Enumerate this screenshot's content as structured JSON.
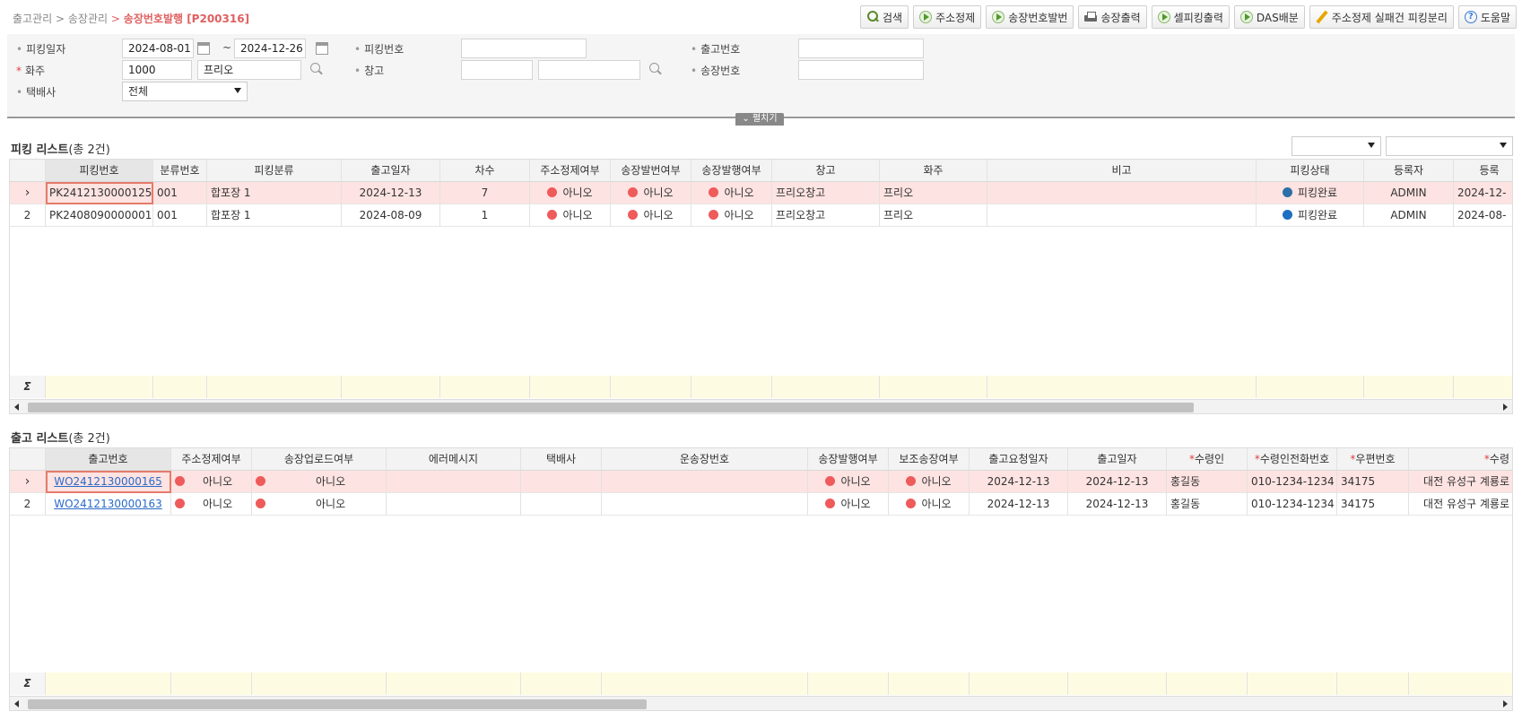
{
  "breadcrumb": {
    "level1": "출고관리",
    "level2": "송장관리",
    "current": "송장번호발행 [P200316]",
    "sep": ">"
  },
  "toolbar": {
    "buttons": [
      {
        "label": "검색",
        "icon": "search-icon"
      },
      {
        "label": "주소정제",
        "icon": "play-icon"
      },
      {
        "label": "송장번호발번",
        "icon": "play-icon"
      },
      {
        "label": "송장출력",
        "icon": "printer-icon"
      },
      {
        "label": "셀피킹출력",
        "icon": "play-icon"
      },
      {
        "label": "DAS배분",
        "icon": "play-icon"
      },
      {
        "label": "주소정제 실패건 피킹분리",
        "icon": "pencil-icon"
      },
      {
        "label": "도움말",
        "icon": "help-icon"
      }
    ]
  },
  "search": {
    "picking_date_label": "피킹일자",
    "date_from": "2024-08-01",
    "date_tilde": "~",
    "date_to": "2024-12-26",
    "owner_label": "화주",
    "owner_code": "1000",
    "owner_name": "프리오",
    "carrier_label": "택배사",
    "carrier_value": "전체",
    "picking_no_label": "피킹번호",
    "picking_no_value": "",
    "warehouse_label": "창고",
    "warehouse_code": "",
    "warehouse_name": "",
    "outbound_no_label": "출고번호",
    "outbound_no_value": "",
    "invoice_no_label": "송장번호",
    "invoice_no_value": "",
    "fold_label": "펼치기"
  },
  "picking_list": {
    "title": "피킹 리스트",
    "count": "(총 2건)",
    "columns": [
      "피킹번호",
      "분류번호",
      "피킹분류",
      "출고일자",
      "차수",
      "주소정제여부",
      "송장발번여부",
      "송장발행여부",
      "창고",
      "화주",
      "비고",
      "피킹상태",
      "등록자",
      "등록"
    ],
    "rows": [
      {
        "rownum": "",
        "picking_no": "PK2412130000125",
        "class_no": "001",
        "picking_class": "합포장 1",
        "out_date": "2024-12-13",
        "seq": "7",
        "addr_clean": "아니오",
        "inv_issue_no": "아니오",
        "inv_print": "아니오",
        "warehouse": "프리오창고",
        "owner": "프리오",
        "note": "",
        "status": "피킹완료",
        "reg_user": "ADMIN",
        "reg_date": "2024-12-"
      },
      {
        "rownum": "2",
        "picking_no": "PK2408090000001",
        "class_no": "001",
        "picking_class": "합포장 1",
        "out_date": "2024-08-09",
        "seq": "1",
        "addr_clean": "아니오",
        "inv_issue_no": "아니오",
        "inv_print": "아니오",
        "warehouse": "프리오창고",
        "owner": "프리오",
        "note": "",
        "status": "피킹완료",
        "reg_user": "ADMIN",
        "reg_date": "2024-08-"
      }
    ],
    "sum_symbol": "Σ"
  },
  "outbound_list": {
    "title": "출고 리스트",
    "count": "(총 2건)",
    "columns": [
      "출고번호",
      "주소정제여부",
      "송장업로드여부",
      "에러메시지",
      "택배사",
      "운송장번호",
      "송장발행여부",
      "보조송장여부",
      "출고요청일자",
      "출고일자",
      "수령인",
      "수령인전화번호",
      "우편번호",
      "수령"
    ],
    "required_mark": "*",
    "rows": [
      {
        "rownum": "",
        "out_no": "WO2412130000165",
        "addr_clean": "아니오",
        "inv_upload": "아니오",
        "error_msg": "",
        "carrier": "",
        "waybill": "",
        "inv_print": "아니오",
        "sub_inv": "아니오",
        "req_date": "2024-12-13",
        "out_date": "2024-12-13",
        "receiver": "홍길동",
        "phone": "010-1234-1234",
        "zip": "34175",
        "address": "대전 유성구 계룡로"
      },
      {
        "rownum": "2",
        "out_no": "WO2412130000163",
        "addr_clean": "아니오",
        "inv_upload": "아니오",
        "error_msg": "",
        "carrier": "",
        "waybill": "",
        "inv_print": "아니오",
        "sub_inv": "아니오",
        "req_date": "2024-12-13",
        "out_date": "2024-12-13",
        "receiver": "홍길동",
        "phone": "010-1234-1234",
        "zip": "34175",
        "address": "대전 유성구 계룡로"
      }
    ],
    "sum_symbol": "Σ"
  },
  "colors": {
    "selected_row": "#fde3e1",
    "status_red": "#ef5a5a",
    "status_blue": "#1e6fc0",
    "summary_bg": "#fefbe3",
    "breadcrumb_current": "#e06060"
  }
}
